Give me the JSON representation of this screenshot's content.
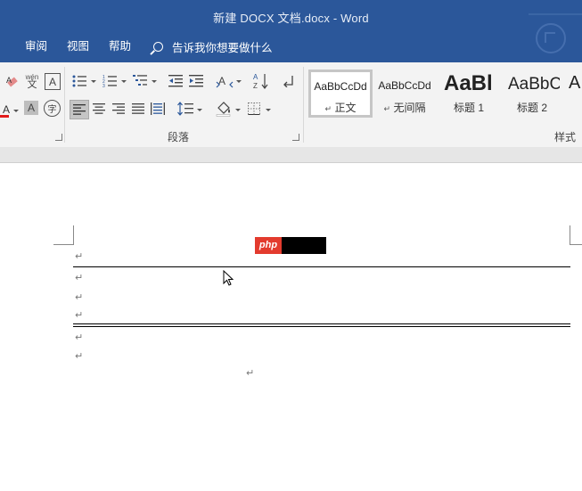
{
  "window": {
    "title": "新建 DOCX 文档.docx  -  Word"
  },
  "menu": {
    "items": [
      "审阅",
      "视图",
      "帮助"
    ],
    "tell_me": "告诉我你想要做什么"
  },
  "ribbon": {
    "paragraph_group_label": "段落",
    "styles_group_label": "样式",
    "styles": [
      {
        "sample": "AaBbCcDd",
        "name": "正文",
        "selected": true,
        "has_mark": true
      },
      {
        "sample": "AaBbCcDd",
        "name": "无间隔",
        "selected": false,
        "has_mark": true
      },
      {
        "sample": "AaBl",
        "name": "标题 1",
        "selected": false,
        "has_mark": false
      },
      {
        "sample": "AaBbC",
        "name": "标题 2",
        "selected": false,
        "has_mark": false
      },
      {
        "sample": "A",
        "name": "",
        "selected": false,
        "has_mark": false
      }
    ]
  },
  "document": {
    "paragraph_mark": "↵",
    "logo_text": "php"
  },
  "colors": {
    "titlebar": "#2b579a",
    "ribbon": "#f3f3f3",
    "logo_red": "#e33b2e"
  }
}
